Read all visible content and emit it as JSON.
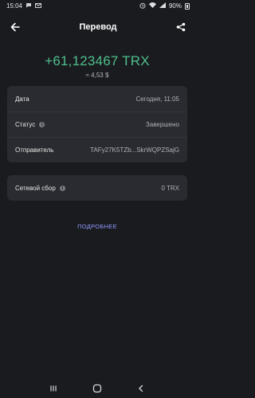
{
  "status_bar": {
    "time": "15:04",
    "battery": "90%",
    "icons": [
      "chat-icon",
      "mail-icon",
      "alarm-icon",
      "wifi-icon",
      "signal-icon",
      "battery-icon"
    ]
  },
  "header": {
    "title": "Перевод",
    "back_icon": "arrow-left-icon",
    "share_icon": "share-icon"
  },
  "amount": {
    "value": "+61,123467 TRX",
    "fiat": "≈ 4,53 $",
    "color": "#4fbf8d"
  },
  "details": {
    "date_label": "Дата",
    "date_value": "Сегодня, 11:05",
    "status_label": "Статус",
    "status_value": "Завершено",
    "sender_label": "Отправитель",
    "sender_value": "TAFy27K5TZb...SkrWQPZSajG"
  },
  "fee": {
    "label": "Сетевой сбор",
    "value": "0 TRX"
  },
  "more_label": "ПОДРОБНЕЕ",
  "accent_color": "#8f9bff",
  "nav": {
    "icons": [
      "recent-apps-icon",
      "home-icon",
      "back-icon"
    ]
  }
}
